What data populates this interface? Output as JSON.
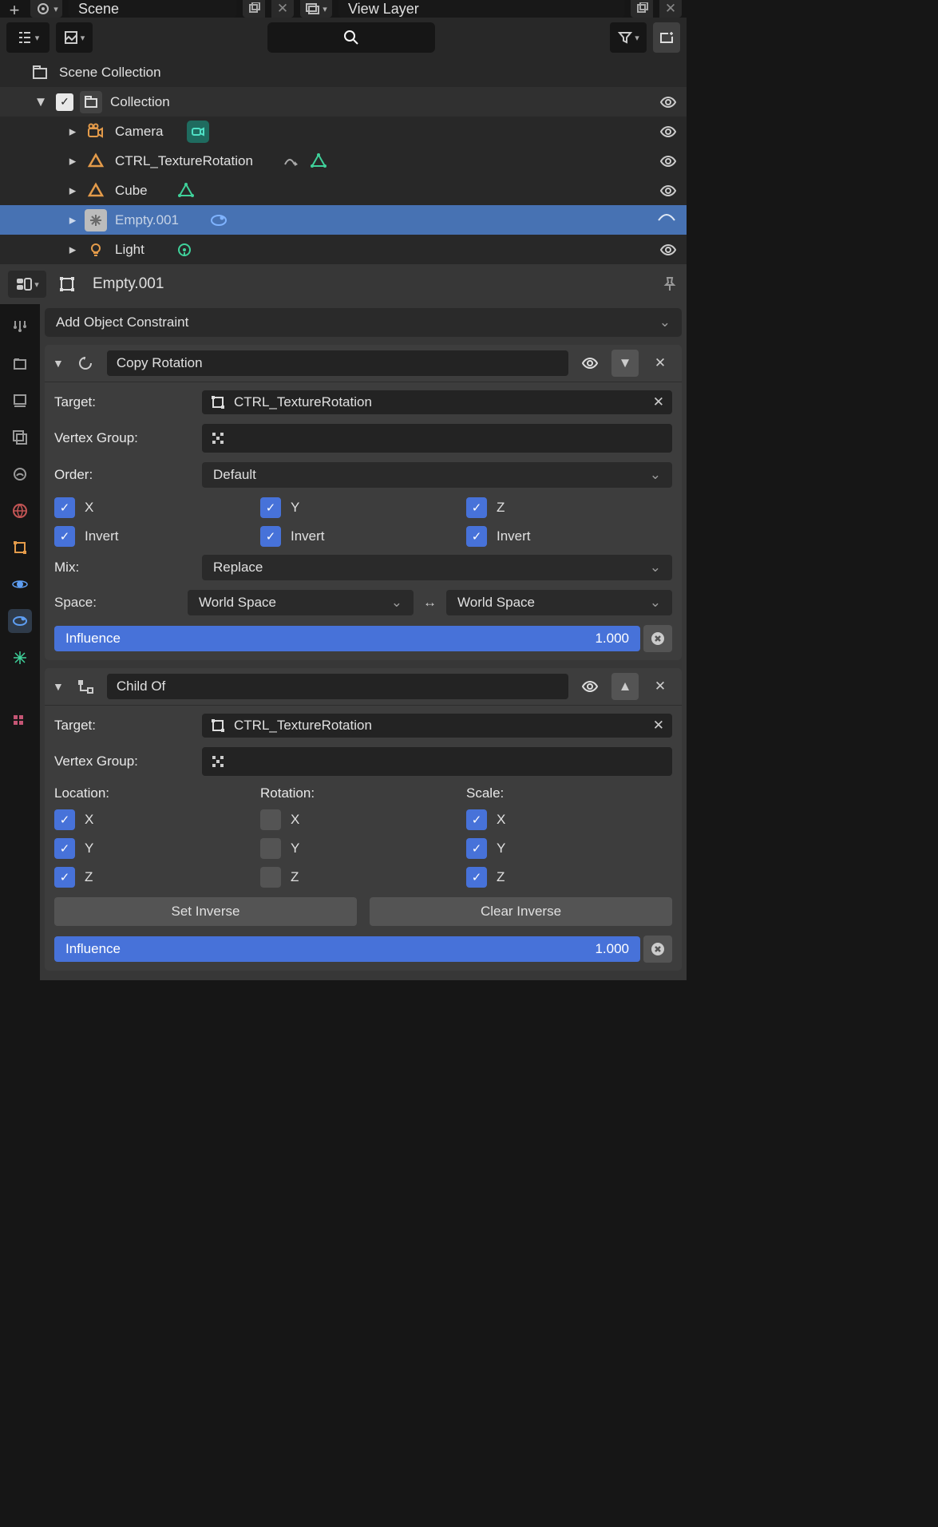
{
  "header": {
    "scene_label": "Scene",
    "viewlayer_label": "View Layer"
  },
  "outliner": {
    "root": "Scene Collection",
    "collection": "Collection",
    "items": [
      {
        "name": "Camera"
      },
      {
        "name": "CTRL_TextureRotation"
      },
      {
        "name": "Cube"
      },
      {
        "name": "Empty.001"
      },
      {
        "name": "Light"
      }
    ]
  },
  "breadcrumb": {
    "object": "Empty.001"
  },
  "add_constraint": "Add Object Constraint",
  "constraints": {
    "copy_rotation": {
      "name": "Copy Rotation",
      "target_label": "Target:",
      "target_value": "CTRL_TextureRotation",
      "vg_label": "Vertex Group:",
      "order_label": "Order:",
      "order_value": "Default",
      "axes": {
        "x": "X",
        "y": "Y",
        "z": "Z",
        "invert": "Invert"
      },
      "mix_label": "Mix:",
      "mix_value": "Replace",
      "space_label": "Space:",
      "space_from": "World Space",
      "space_to": "World Space",
      "influence_label": "Influence",
      "influence_value": "1.000"
    },
    "child_of": {
      "name": "Child Of",
      "target_label": "Target:",
      "target_value": "CTRL_TextureRotation",
      "vg_label": "Vertex Group:",
      "col_loc": "Location:",
      "col_rot": "Rotation:",
      "col_scale": "Scale:",
      "x": "X",
      "y": "Y",
      "z": "Z",
      "set_inverse": "Set Inverse",
      "clear_inverse": "Clear Inverse",
      "influence_label": "Influence",
      "influence_value": "1.000"
    }
  }
}
